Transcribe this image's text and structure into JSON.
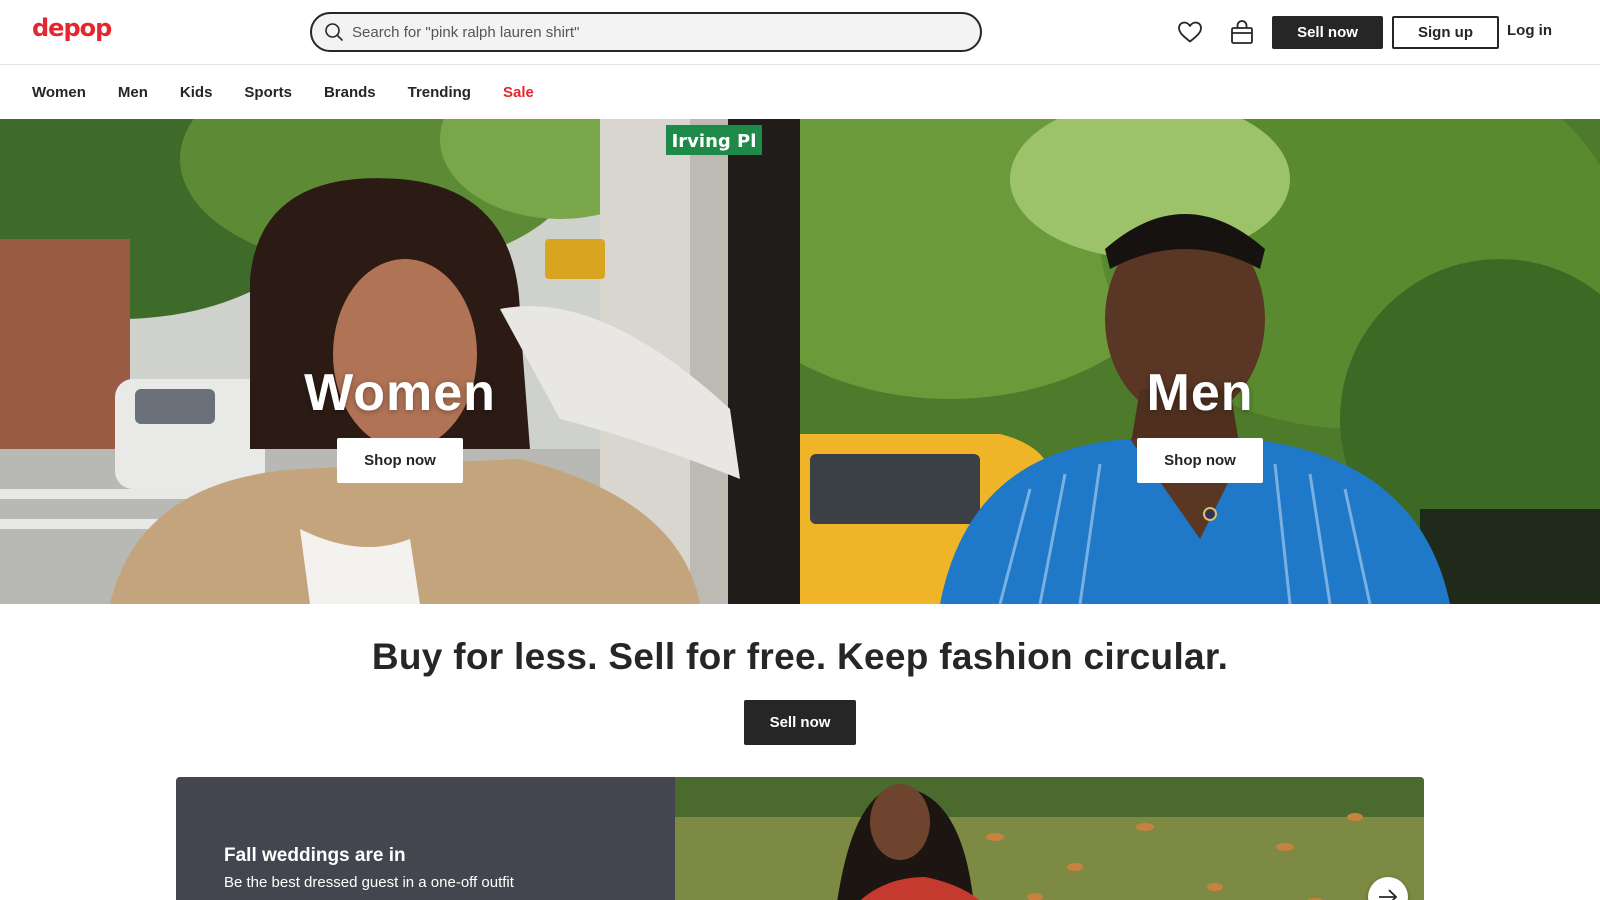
{
  "header": {
    "logo": "depop",
    "search_placeholder": "Search for \"pink ralph lauren shirt\"",
    "sell_label": "Sell now",
    "signup_label": "Sign up",
    "login_label": "Log in",
    "icons": [
      "search-icon",
      "heart-icon",
      "bag-icon"
    ]
  },
  "nav": {
    "items": [
      "Women",
      "Men",
      "Kids",
      "Sports",
      "Brands",
      "Trending"
    ],
    "sale": "Sale",
    "sale_color": "#e3262f"
  },
  "hero": {
    "left": {
      "title": "Women",
      "cta": "Shop now",
      "sign": "Irving Pl"
    },
    "right": {
      "title": "Men",
      "cta": "Shop now"
    }
  },
  "tagline": {
    "text": "Buy for less. Sell for free. Keep fashion circular.",
    "cta": "Sell now"
  },
  "promo": {
    "title": "Fall weddings are in",
    "subtitle": "Be the best dressed guest in a one-off outfit"
  },
  "colors": {
    "brand": "#e3262f",
    "dark": "#262626",
    "promo_bg": "#44464f"
  }
}
